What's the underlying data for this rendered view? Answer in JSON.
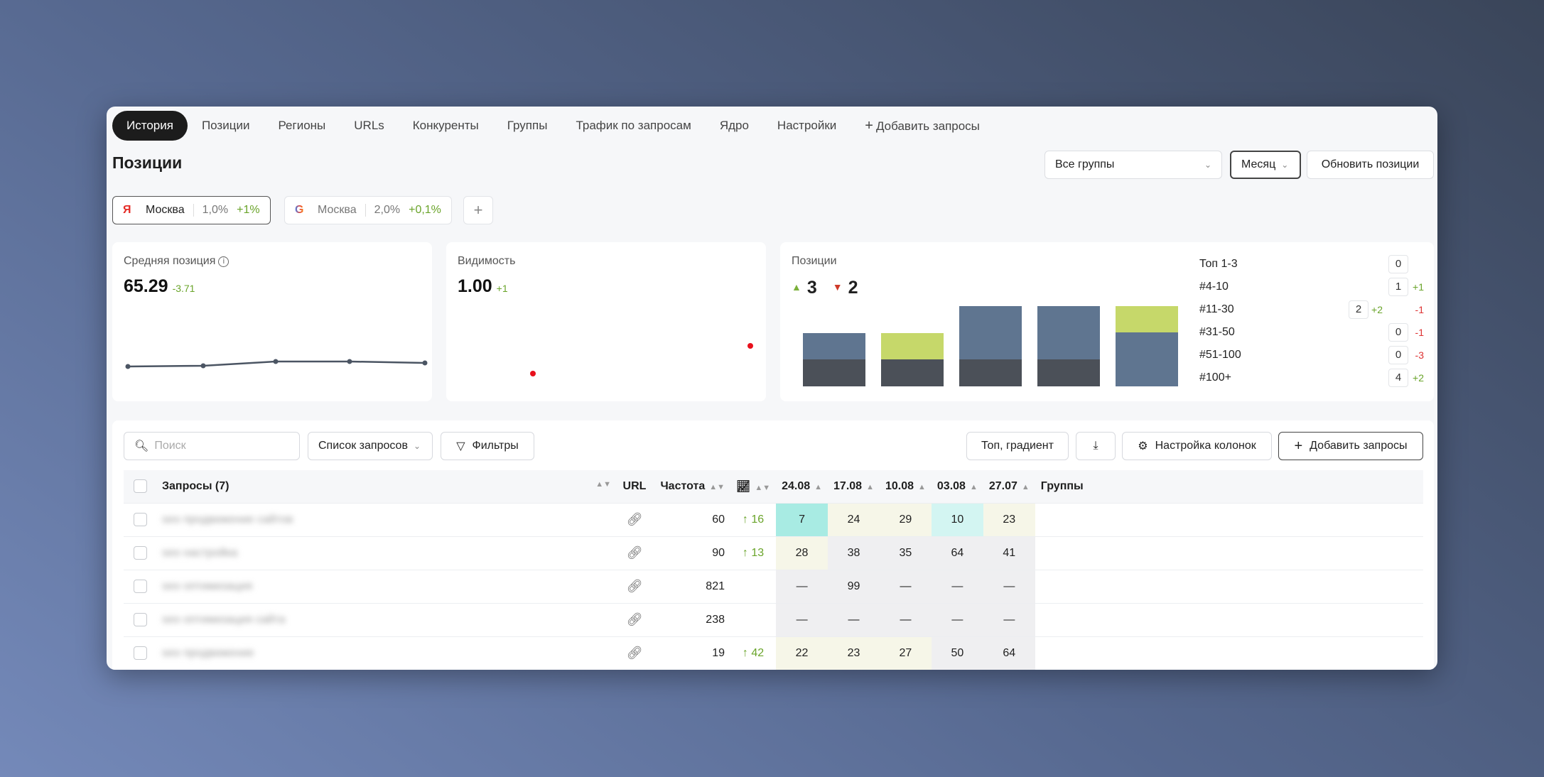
{
  "tabs": [
    {
      "label": "История"
    },
    {
      "label": "Позиции"
    },
    {
      "label": "Регионы"
    },
    {
      "label": "URLs"
    },
    {
      "label": "Конкуренты"
    },
    {
      "label": "Группы"
    },
    {
      "label": "Трафик по запросам"
    },
    {
      "label": "Ядро"
    },
    {
      "label": "Настройки"
    },
    {
      "label": "Добавить запросы"
    }
  ],
  "header": {
    "title": "Позиции",
    "groups_select": "Все группы",
    "period_select": "Месяц",
    "update_button": "Обновить позиции"
  },
  "regions": [
    {
      "engine": "Я",
      "city": "Москва",
      "pct": "1,0%",
      "delta": "+1%"
    },
    {
      "engine": "G",
      "city": "Москва",
      "pct": "2,0%",
      "delta": "+0,1%"
    }
  ],
  "add_region": "+",
  "avg_card": {
    "title": "Средняя позиция",
    "value": "65.29",
    "delta": "-3.71",
    "info": "i"
  },
  "vis_card": {
    "title": "Видимость",
    "value": "1.00",
    "delta": "+1"
  },
  "pos_card": {
    "title": "Позиции",
    "up": "3",
    "down": "2",
    "legend": [
      {
        "label": "Топ 1-3",
        "value": "0",
        "delta": ""
      },
      {
        "label": "#4-10",
        "value": "1",
        "delta": "+1"
      },
      {
        "label": "#11-30",
        "value": "2",
        "mid": "+2",
        "delta": "-1"
      },
      {
        "label": "#31-50",
        "value": "0",
        "delta": "-1"
      },
      {
        "label": "#51-100",
        "value": "0",
        "delta": "-3"
      },
      {
        "label": "#100+",
        "value": "4",
        "delta": "+2"
      }
    ]
  },
  "colors": {
    "bar_dark": "#4b5058",
    "bar_blue": "#5f7590",
    "bar_lime": "#c6d86a",
    "line": "#4b5563",
    "dot_red": "#e8101c"
  },
  "toolbar": {
    "search_placeholder": "Поиск",
    "list_select": "Список запросов",
    "filters": "Фильтры",
    "top_gradient": "Топ, градиент",
    "columns": "Настройка колонок",
    "add_queries": "Добавить запросы"
  },
  "table": {
    "col_queries": "Запросы (7)",
    "col_url": "URL",
    "col_freq": "Частота",
    "dates": [
      "24.08",
      "17.08",
      "10.08",
      "03.08",
      "27.07"
    ],
    "col_groups": "Группы",
    "rows": [
      {
        "query": "seo продвижение сайтов",
        "freq": "60",
        "dyn": "16",
        "pos": [
          "7",
          "24",
          "29",
          "10",
          "23"
        ]
      },
      {
        "query": "seo настройка",
        "freq": "90",
        "dyn": "13",
        "pos": [
          "28",
          "38",
          "35",
          "64",
          "41"
        ]
      },
      {
        "query": "seo оптимизация",
        "freq": "821",
        "dyn": "",
        "pos": [
          "—",
          "99",
          "—",
          "—",
          "—"
        ]
      },
      {
        "query": "seo оптимизация сайта",
        "freq": "238",
        "dyn": "",
        "pos": [
          "—",
          "—",
          "—",
          "—",
          "—"
        ]
      },
      {
        "query": "seo продвижение",
        "freq": "19",
        "dyn": "42",
        "pos": [
          "22",
          "23",
          "27",
          "50",
          "64"
        ]
      }
    ]
  }
}
